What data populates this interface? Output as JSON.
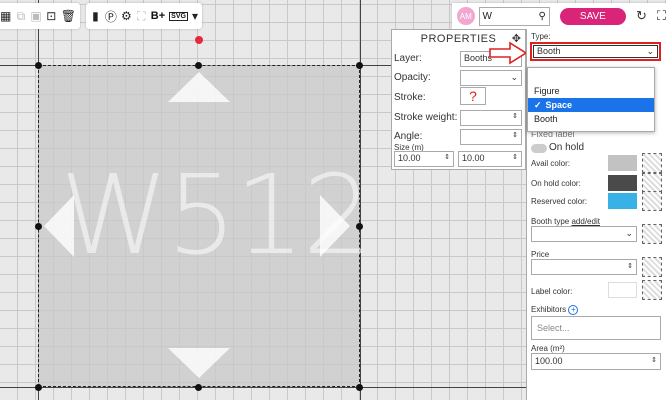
{
  "canvas": {
    "booth_label": "W512"
  },
  "toolbar_left": {
    "buttons": [
      "grid-icon",
      "copy-icon",
      "crop-icon",
      "image-icon",
      "trash-icon"
    ]
  },
  "toolbar_mid": {
    "buttons": [
      "chart-icon",
      "p-icon",
      "gear-icon",
      "expand-icon"
    ],
    "b_plus_label": "B+",
    "svg_label": "SVG"
  },
  "topbar": {
    "avatar_initials": "AM",
    "search_value": "W",
    "save_label": "SAVE"
  },
  "properties": {
    "title": "PROPERTIES",
    "layer_label": "Layer:",
    "layer_value": "Booths",
    "opacity_label": "Opacity:",
    "stroke_label": "Stroke:",
    "stroke_value": "?",
    "stroke_weight_label": "Stroke weight:",
    "angle_label": "Angle:",
    "size_label": "Size (m)",
    "width_value": "10.00",
    "height_value": "10.00"
  },
  "right_panel": {
    "type_label": "Type:",
    "type_value": "Booth",
    "type_options": [
      "Figure",
      "Space",
      "Booth"
    ],
    "type_selected": "Space",
    "fixed_label": "Fixed label",
    "on_hold_label": "On hold",
    "avail_color_label": "Avail color:",
    "on_hold_color_label": "On hold color:",
    "reserved_color_label": "Reserved color:",
    "booth_type_label": "Booth type",
    "booth_type_link": "add/edit",
    "price_label": "Price",
    "label_color_label": "Label color:",
    "exhibitors_label": "Exhibitors",
    "exhibitors_placeholder": "Select...",
    "area_label": "Area (m²)",
    "area_value": "100.00",
    "colors": {
      "avail": "#c2c2c2",
      "on_hold": "#4a4a4a",
      "reserved": "#39b1e6"
    }
  },
  "accent": "#d9247a"
}
